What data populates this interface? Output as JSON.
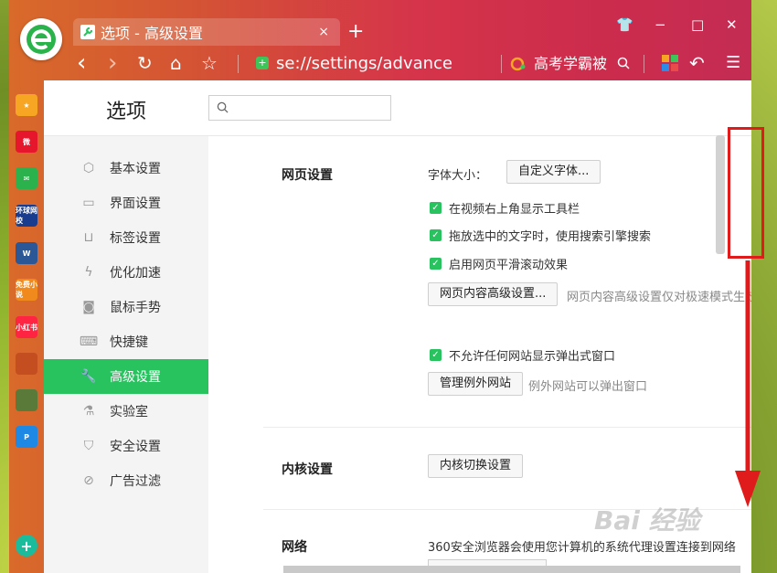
{
  "tab": {
    "title": "选项 - 高级设置",
    "close": "×",
    "new_tab": "+"
  },
  "window_controls": {
    "skin": "👕",
    "minimize": "−",
    "maximize": "□",
    "close": "✕"
  },
  "toolbar": {
    "back": "‹",
    "forward": "›",
    "refresh": "↻",
    "home": "⌂",
    "favorite": "☆",
    "address": "se://settings/advance",
    "hot_search": "高考学霸被",
    "undo": "↶",
    "menu": "☰"
  },
  "sidebar_apps": [
    {
      "name": "收藏",
      "label": "★",
      "color": "#f6a623"
    },
    {
      "name": "微博",
      "label": "微",
      "color": "#e6162d"
    },
    {
      "name": "邮件",
      "label": "✉",
      "color": "#2bb24c"
    },
    {
      "name": "环球网校",
      "label": "环球网校",
      "color": "#1a3c8e"
    },
    {
      "name": "文档",
      "label": "W",
      "color": "#2b5797"
    },
    {
      "name": "免费小说",
      "label": "免费小说",
      "color": "#f08a1c"
    },
    {
      "name": "小红书",
      "label": "小红书",
      "color": "#ff2442"
    },
    {
      "name": "游戏1",
      "label": "",
      "color": "#c44e1f"
    },
    {
      "name": "游戏2",
      "label": "",
      "color": "#5a7a3a"
    },
    {
      "name": "P应用",
      "label": "P",
      "color": "#1e88e5"
    },
    {
      "name": "添加",
      "label": "+",
      "color": "#1abc9c"
    }
  ],
  "page": {
    "title": "选项",
    "search_placeholder": ""
  },
  "nav": [
    {
      "label": "基本设置",
      "icon": "⬡"
    },
    {
      "label": "界面设置",
      "icon": "▭"
    },
    {
      "label": "标签设置",
      "icon": "⊔"
    },
    {
      "label": "优化加速",
      "icon": "ϟ"
    },
    {
      "label": "鼠标手势",
      "icon": "◙"
    },
    {
      "label": "快捷键",
      "icon": "⌨"
    },
    {
      "label": "高级设置",
      "icon": "🔧"
    },
    {
      "label": "实验室",
      "icon": "⚗"
    },
    {
      "label": "安全设置",
      "icon": "⛉"
    },
    {
      "label": "广告过滤",
      "icon": "⊘"
    }
  ],
  "web_settings": {
    "title": "网页设置",
    "font_size_label": "字体大小：",
    "custom_font_button": "自定义字体...",
    "checkboxes": [
      "在视频右上角显示工具栏",
      "拖放选中的文字时，使用搜索引擎搜索",
      "启用网页平滑滚动效果"
    ],
    "advanced_button": "网页内容高级设置...",
    "advanced_hint": "网页内容高级设置仅对极速模式生效",
    "popup_checkbox": "不允许任何网站显示弹出式窗口",
    "exceptions_button": "管理例外网站",
    "exceptions_hint": "例外网站可以弹出窗口"
  },
  "kernel_settings": {
    "title": "内核设置",
    "button": "内核切换设置"
  },
  "network": {
    "title": "网络",
    "text": "360安全浏览器会使用您计算机的系统代理设置连接到网络"
  },
  "watermark": "Bai 经验",
  "colors": {
    "accent": "#28c35f",
    "annotation": "#e01b1b"
  }
}
